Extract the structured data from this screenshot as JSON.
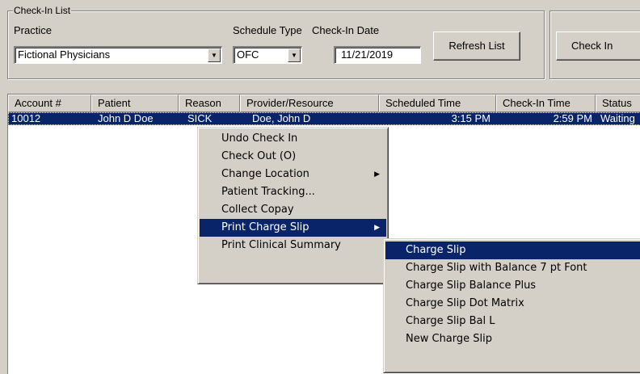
{
  "checkin": {
    "group_label": "Check-In List",
    "practice_label": "Practice",
    "practice_value": "Fictional Physicians",
    "schedule_type_label": "Schedule Type",
    "schedule_type_value": "OFC",
    "checkin_date_label": "Check-In Date",
    "checkin_date_value": "11/21/2019",
    "refresh_button": "Refresh List",
    "checkin_button": "Check In"
  },
  "table": {
    "columns": [
      "Account #",
      "Patient",
      "Reason",
      "Provider/Resource",
      "Scheduled Time",
      "Check-In Time",
      "Status"
    ],
    "rows": [
      {
        "account": "10012",
        "patient": "John D Doe",
        "reason": "SICK",
        "provider": "Doe, John D",
        "scheduled": "3:15 PM",
        "checkin": "2:59 PM",
        "status": "Waiting"
      }
    ]
  },
  "context_menu": {
    "items": [
      {
        "label": "Undo Check In"
      },
      {
        "label": "Check Out  (O)"
      },
      {
        "label": "Change Location"
      },
      {
        "label": "Patient Tracking..."
      },
      {
        "label": "Collect Copay"
      },
      {
        "label": "Print Charge Slip"
      },
      {
        "label": "Print Clinical Summary"
      }
    ]
  },
  "submenu": {
    "items": [
      {
        "label": "Charge Slip"
      },
      {
        "label": "Charge Slip with Balance 7 pt Font"
      },
      {
        "label": "Charge Slip Balance Plus"
      },
      {
        "label": "Charge Slip Dot Matrix"
      },
      {
        "label": "Charge Slip Bal L"
      },
      {
        "label": "New Charge Slip"
      }
    ]
  },
  "colors": {
    "face": "#d4d0c8",
    "selection": "#0a246a",
    "selection_text": "#ffffff"
  }
}
